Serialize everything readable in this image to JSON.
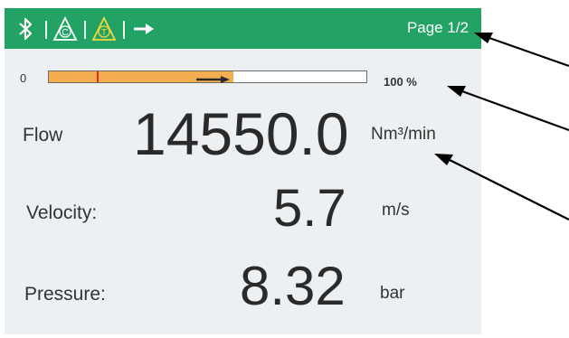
{
  "header": {
    "page_label": "Page 1/2",
    "background": "#23a266",
    "icons": [
      "bluetooth-icon",
      "c-warning-icon",
      "t-warning-icon",
      "right-arrow-icon"
    ]
  },
  "flow_bar": {
    "min_label": "0",
    "percent_label": "100 %",
    "fill_fraction": 0.58,
    "marker_fraction": 0.15,
    "fill_color": "#f4ae4f",
    "marker_color": "#e22a1e"
  },
  "readings": {
    "flow": {
      "label": "Flow",
      "value": "14550.0",
      "unit": "Nm³/min"
    },
    "velocity": {
      "label": "Velocity:",
      "value": "5.7",
      "unit": "m/s"
    },
    "pressure": {
      "label": "Pressure:",
      "value": "8.32",
      "unit": "bar"
    }
  }
}
